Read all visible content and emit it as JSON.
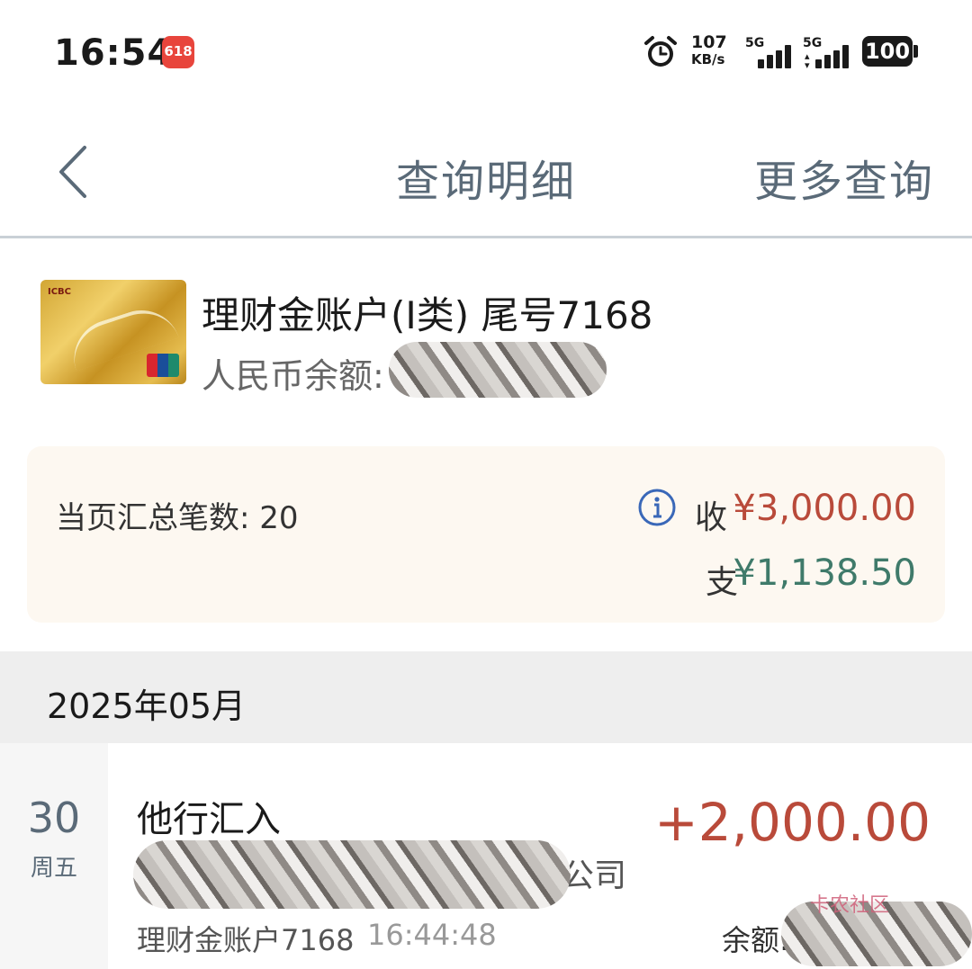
{
  "status_bar": {
    "time": "16:54",
    "badge": "618",
    "speed_value": "107",
    "speed_unit": "KB/s",
    "sim1_label": "5G",
    "sim2_label": "5G",
    "battery": "100"
  },
  "nav": {
    "title": "查询明细",
    "more": "更多查询"
  },
  "account": {
    "name": "理财金账户(Ⅰ类)  尾号7168",
    "balance_label": "人民币余额:"
  },
  "summary": {
    "count_label": "当页汇总笔数: 20",
    "income_label": "收",
    "income": "¥3,000.00",
    "expense_label": "支",
    "expense": "¥1,138.50"
  },
  "month": "2025年05月",
  "transaction": {
    "day": "30",
    "weekday": "周五",
    "type": "他行汇入",
    "amount": "+2,000.00",
    "party_suffix": "公司",
    "account": "理财金账户7168",
    "time": "16:44:48",
    "balance_label": "余额:"
  },
  "watermark": "卡农社区",
  "colors": {
    "income": "#b94a3a",
    "expense": "#3f7a6a",
    "nav_text": "#5a6a78",
    "summary_bg": "#fdf8f1"
  },
  "icons": [
    "alarm-icon",
    "back-chevron-icon",
    "info-icon",
    "unionpay-logo"
  ]
}
